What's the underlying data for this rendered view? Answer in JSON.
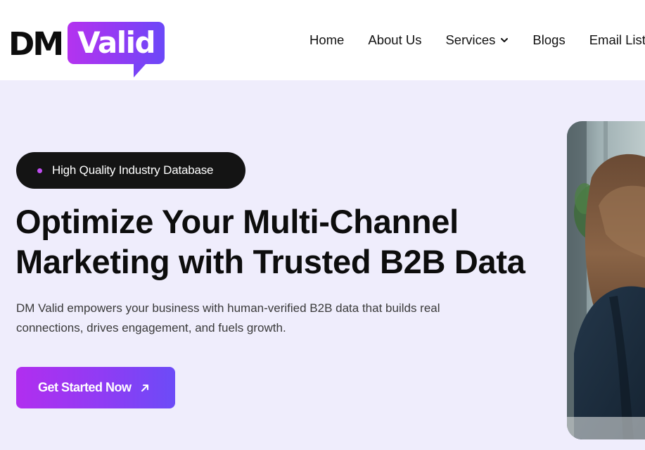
{
  "brand": {
    "logo_left": "DM",
    "logo_right": "Valid"
  },
  "nav": {
    "items": [
      {
        "label": "Home"
      },
      {
        "label": "About Us"
      },
      {
        "label": "Services"
      },
      {
        "label": "Blogs"
      },
      {
        "label": "Email List"
      }
    ]
  },
  "hero": {
    "badge": "High Quality Industry Database",
    "headline_line1": "Optimize Your Multi-Channel",
    "headline_line2": "Marketing with Trusted B2B Data",
    "desc_line1": "DM Valid empowers your business with human-verified B2B data that builds real",
    "desc_line2": "connections, drives engagement, and fuels growth.",
    "cta_label": "Get Started Now"
  },
  "colors": {
    "accent_start": "#b12eef",
    "accent_end": "#6c4bf7",
    "hero_bg": "#efedfc",
    "badge_bg": "#141414"
  },
  "icons": {
    "services_dropdown": "chevron-down-icon",
    "email_dropdown": "chevron-down-icon",
    "cta": "arrow-up-right-icon"
  }
}
